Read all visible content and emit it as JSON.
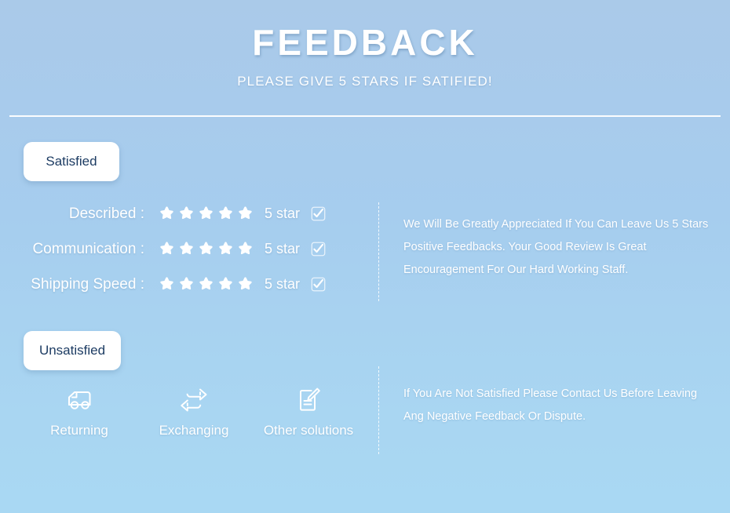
{
  "header": {
    "title": "FEEDBACK",
    "subtitle": "PLEASE GIVE 5 STARS IF SATIFIED!"
  },
  "colors": {
    "background_top": "#aacae9",
    "background_bottom": "#a9d8f3",
    "badge_background": "#ffffff",
    "badge_text": "#1d3c63",
    "text": "#ffffff",
    "divider": "#ffffff"
  },
  "satisfied": {
    "badge_label": "Satisfied",
    "ratings": [
      {
        "label": "Described :",
        "stars": 5,
        "value": "5 star",
        "checked": true
      },
      {
        "label": "Communication :",
        "stars": 5,
        "value": "5 star",
        "checked": true
      },
      {
        "label": "Shipping Speed :",
        "stars": 5,
        "value": "5 star",
        "checked": true
      }
    ],
    "note": "We Will Be Greatly Appreciated If You Can Leave Us 5 Stars Positive Feedbacks. Your Good Review Is Great Encouragement For Our Hard Working Staff."
  },
  "unsatisfied": {
    "badge_label": "Unsatisfied",
    "solutions": [
      {
        "label": "Returning",
        "icon": "truck-icon"
      },
      {
        "label": "Exchanging",
        "icon": "exchange-arrows-icon"
      },
      {
        "label": "Other solutions",
        "icon": "document-pencil-icon"
      }
    ],
    "note": "If You Are Not Satisfied Please Contact Us Before Leaving Ang Negative Feedback Or Dispute."
  },
  "icons": {
    "star": "star-icon",
    "checkbox": "checkbox-checked-icon"
  }
}
